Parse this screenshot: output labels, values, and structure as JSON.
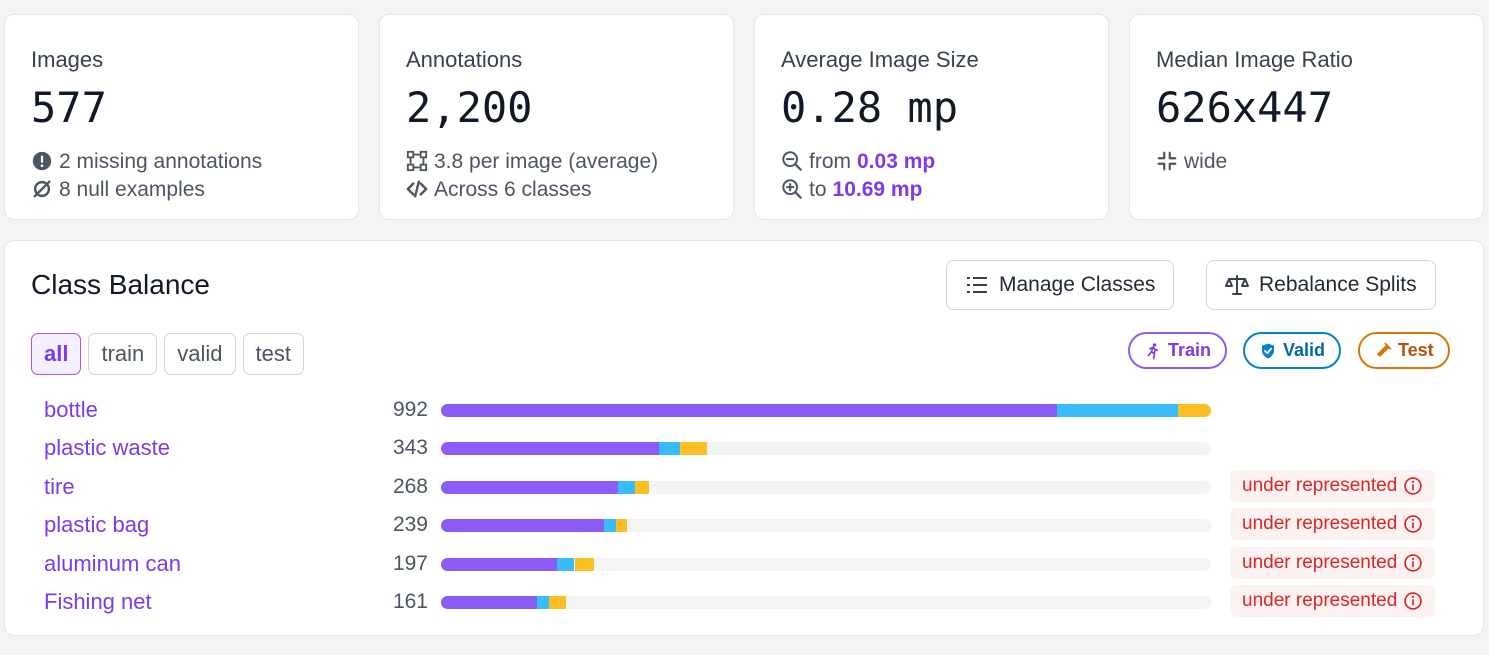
{
  "stats": {
    "images": {
      "label": "Images",
      "value": "577",
      "line1": "2 missing annotations",
      "line2": "8 null examples",
      "icon1": "exclamation-circle-icon",
      "icon2": "null-set-icon"
    },
    "annotations": {
      "label": "Annotations",
      "value": "2,200",
      "line1": "3.8 per image (average)",
      "line2": "Across 6 classes",
      "icon1": "bounding-box-icon",
      "icon2": "code-icon"
    },
    "avg_size": {
      "label": "Average Image Size",
      "value": "0.28 mp",
      "from_label": "from",
      "from_value": "0.03 mp",
      "to_label": "to",
      "to_value": "10.69 mp",
      "icon1": "zoom-out-icon",
      "icon2": "zoom-in-icon"
    },
    "ratio": {
      "label": "Median Image Ratio",
      "value": "626x447",
      "line1": "wide",
      "icon1": "compress-icon"
    }
  },
  "class_balance": {
    "title": "Class Balance",
    "manage_label": "Manage Classes",
    "rebalance_label": "Rebalance Splits",
    "tabs": [
      "all",
      "train",
      "valid",
      "test"
    ],
    "active_tab": "all",
    "legend": [
      {
        "label": "Train",
        "color": "#8b5cf6",
        "icon": "running-icon"
      },
      {
        "label": "Valid",
        "color": "#0284c7",
        "icon": "shield-check-icon"
      },
      {
        "label": "Test",
        "color": "#d97706",
        "icon": "flask-icon"
      }
    ],
    "split_colors": {
      "train": "#8b5cf6",
      "valid": "#38bdf8",
      "test": "#fbbf24"
    },
    "max_count": 992,
    "warning_label": "under represented",
    "rows": [
      {
        "name": "bottle",
        "count": "992",
        "train": 794,
        "valid": 155,
        "test": 43,
        "warning": false
      },
      {
        "name": "plastic waste",
        "count": "343",
        "train": 281,
        "valid": 27,
        "test": 35,
        "warning": false
      },
      {
        "name": "tire",
        "count": "268",
        "train": 228,
        "valid": 22,
        "test": 18,
        "warning": true
      },
      {
        "name": "plastic bag",
        "count": "239",
        "train": 210,
        "valid": 16,
        "test": 13,
        "warning": true
      },
      {
        "name": "aluminum can",
        "count": "197",
        "train": 149,
        "valid": 23,
        "test": 25,
        "warning": true
      },
      {
        "name": "Fishing net",
        "count": "161",
        "train": 124,
        "valid": 15,
        "test": 22,
        "warning": true
      }
    ]
  }
}
